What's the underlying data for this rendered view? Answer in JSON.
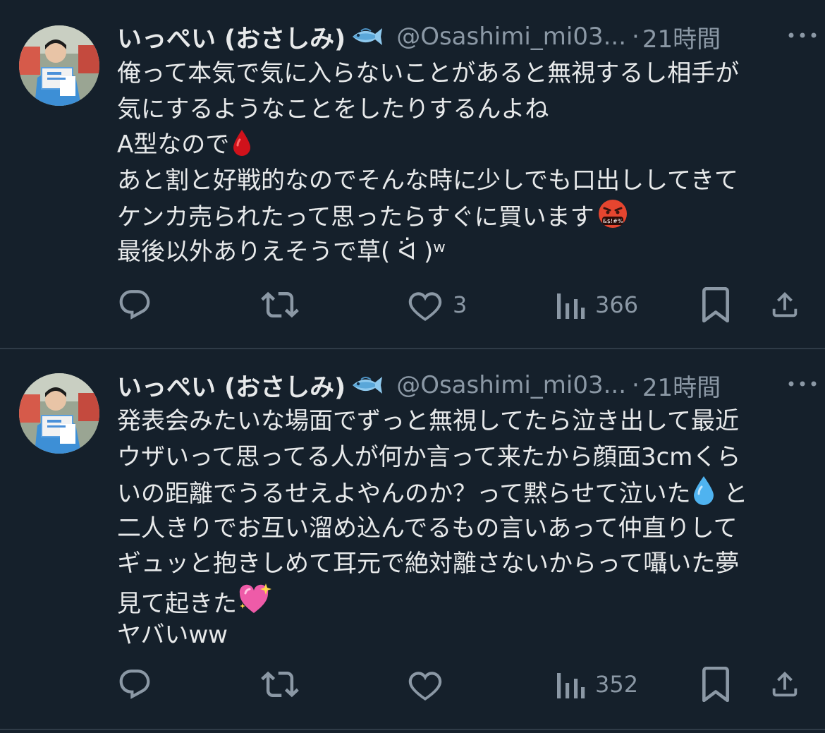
{
  "colors": {
    "background": "#15202b",
    "text": "#e7e9ea",
    "secondary": "#8b98a5",
    "divider": "#2f3b47"
  },
  "tweets": [
    {
      "author_name": "いっぺい (おさしみ)",
      "author_emoji": "fish-icon",
      "handle": "@Osashimi_mi03...",
      "separator": "·",
      "time": "21時間",
      "lines": [
        {
          "text": "俺って本気で気に入らないことがあると無視するし相手が",
          "emoji_after": ""
        },
        {
          "text": "気にするようなことをしたりするんよね",
          "emoji_after": ""
        },
        {
          "text": "A型なので",
          "emoji_after": "drop-of-blood-icon"
        },
        {
          "text": "あと割と好戦的なのでそんな時に少しでも口出ししてきて",
          "emoji_after": ""
        },
        {
          "text": "ケンカ売られたって思ったらすぐに買います",
          "emoji_after": "angry-cursing-face-icon"
        },
        {
          "text": "最後以外ありえそうで草( ᐛ )ʷ",
          "emoji_after": ""
        }
      ],
      "stats": {
        "replies": "",
        "retweets": "",
        "likes": "3",
        "views": "366"
      }
    },
    {
      "author_name": "いっぺい (おさしみ)",
      "author_emoji": "fish-icon",
      "handle": "@Osashimi_mi03...",
      "separator": "·",
      "time": "21時間",
      "lines": [
        {
          "text": "発表会みたいな場面でずっと無視してたら泣き出して最近",
          "emoji_after": ""
        },
        {
          "text": "ウザいって思ってる人が何か言って来たから顔面3cmくら",
          "emoji_after": ""
        },
        {
          "text": "いの距離でうるせえよやんのか？って黙らせて泣いた",
          "emoji_after": "droplet-icon",
          "text_after": " と"
        },
        {
          "text": "二人きりでお互い溜め込んでるもの言いあって仲直りして",
          "emoji_after": ""
        },
        {
          "text": "ギュッと抱きしめて耳元で絶対離さないからって囁いた夢",
          "emoji_after": ""
        },
        {
          "text": "見て起きた",
          "emoji_after": "sparkling-heart-icon"
        },
        {
          "text": "ヤバいww",
          "emoji_after": ""
        }
      ],
      "stats": {
        "replies": "",
        "retweets": "",
        "likes": "",
        "views": "352"
      }
    }
  ]
}
